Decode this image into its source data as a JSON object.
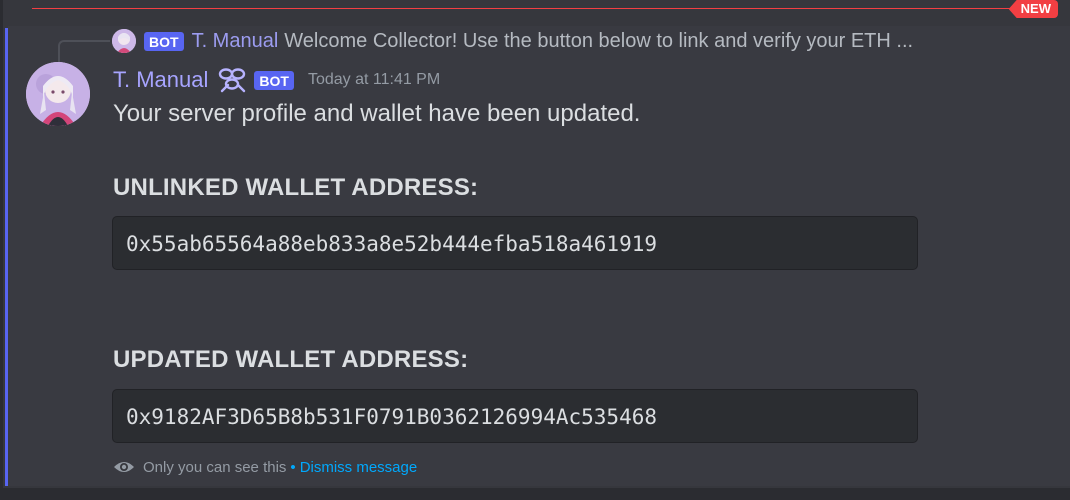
{
  "divider": {
    "badge": "NEW"
  },
  "reply": {
    "bot_tag": "BOT",
    "author": "T. Manual",
    "text": "Welcome Collector! Use the button below to link and verify your ETH ..."
  },
  "message": {
    "author": "T. Manual",
    "bot_tag": "BOT",
    "timestamp": "Today at 11:41 PM",
    "text": "Your server profile and wallet have been updated.",
    "sections": [
      {
        "label": "UNLINKED WALLET ADDRESS:",
        "value": "0x55ab65564a88eb833a8e52b444efba518a461919"
      },
      {
        "label": "UPDATED WALLET ADDRESS:",
        "value": "0x9182AF3D65B8b531F0791B0362126994Ac535468"
      }
    ]
  },
  "footer": {
    "visibility_text": "Only you can see this",
    "separator": "•",
    "dismiss_label": "Dismiss message"
  },
  "colors": {
    "accent": "#5865f2",
    "new_badge": "#f23f43",
    "author": "#a7a4ff",
    "link": "#00a8fc"
  }
}
